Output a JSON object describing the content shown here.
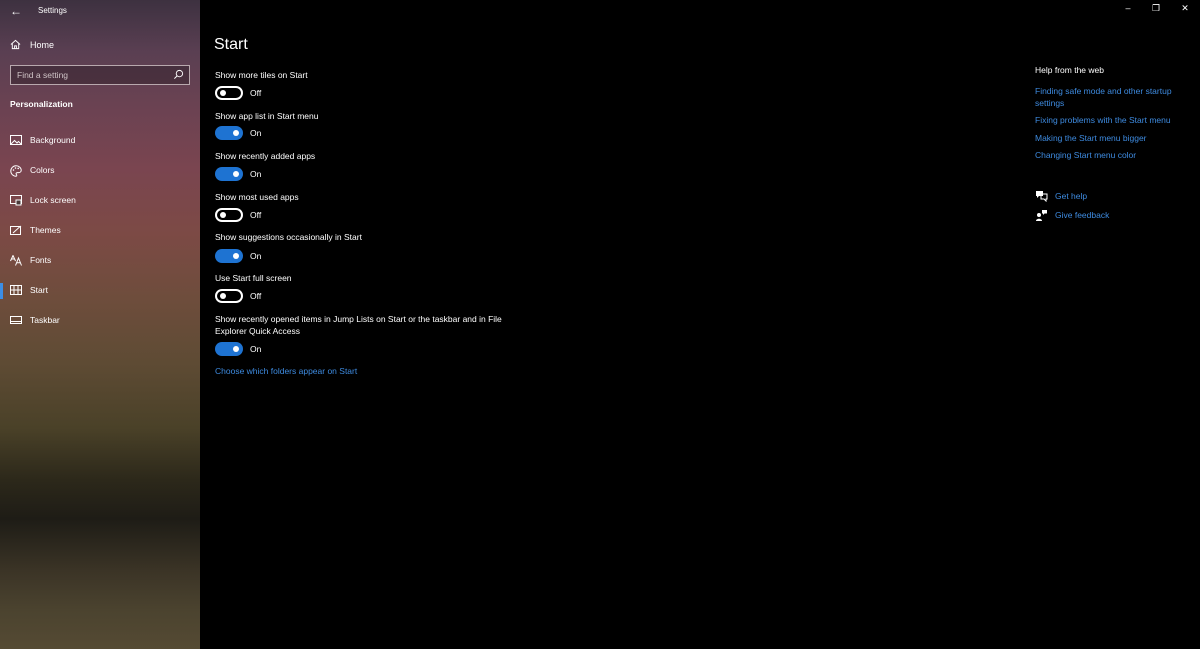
{
  "window": {
    "title": "Settings",
    "back_glyph": "←",
    "minimize_glyph": "–",
    "restore_glyph": "❐",
    "close_glyph": "✕"
  },
  "sidebar": {
    "home_label": "Home",
    "search_placeholder": "Find a setting",
    "section_title": "Personalization",
    "items": [
      {
        "label": "Background",
        "icon": "picture-icon"
      },
      {
        "label": "Colors",
        "icon": "palette-icon"
      },
      {
        "label": "Lock screen",
        "icon": "lock-screen-icon"
      },
      {
        "label": "Themes",
        "icon": "themes-icon"
      },
      {
        "label": "Fonts",
        "icon": "fonts-icon"
      },
      {
        "label": "Start",
        "icon": "start-icon",
        "active": true
      },
      {
        "label": "Taskbar",
        "icon": "taskbar-icon"
      }
    ]
  },
  "main": {
    "page_title": "Start",
    "settings": [
      {
        "label": "Show more tiles on Start",
        "state": "Off"
      },
      {
        "label": "Show app list in Start menu",
        "state": "On"
      },
      {
        "label": "Show recently added apps",
        "state": "On"
      },
      {
        "label": "Show most used apps",
        "state": "Off"
      },
      {
        "label": "Show suggestions occasionally in Start",
        "state": "On"
      },
      {
        "label": "Use Start full screen",
        "state": "Off"
      },
      {
        "label": "Show recently opened items in Jump Lists on Start or the taskbar and in File Explorer Quick Access",
        "state": "On"
      }
    ],
    "folders_link": "Choose which folders appear on Start"
  },
  "help": {
    "title": "Help from the web",
    "links": [
      "Finding safe mode and other startup settings",
      "Fixing problems with the Start menu",
      "Making the Start menu bigger",
      "Changing Start menu color"
    ],
    "get_help": "Get help",
    "give_feedback": "Give feedback"
  },
  "colors": {
    "accent": "#1e73d2",
    "link": "#3e8be0",
    "background": "#000000"
  }
}
